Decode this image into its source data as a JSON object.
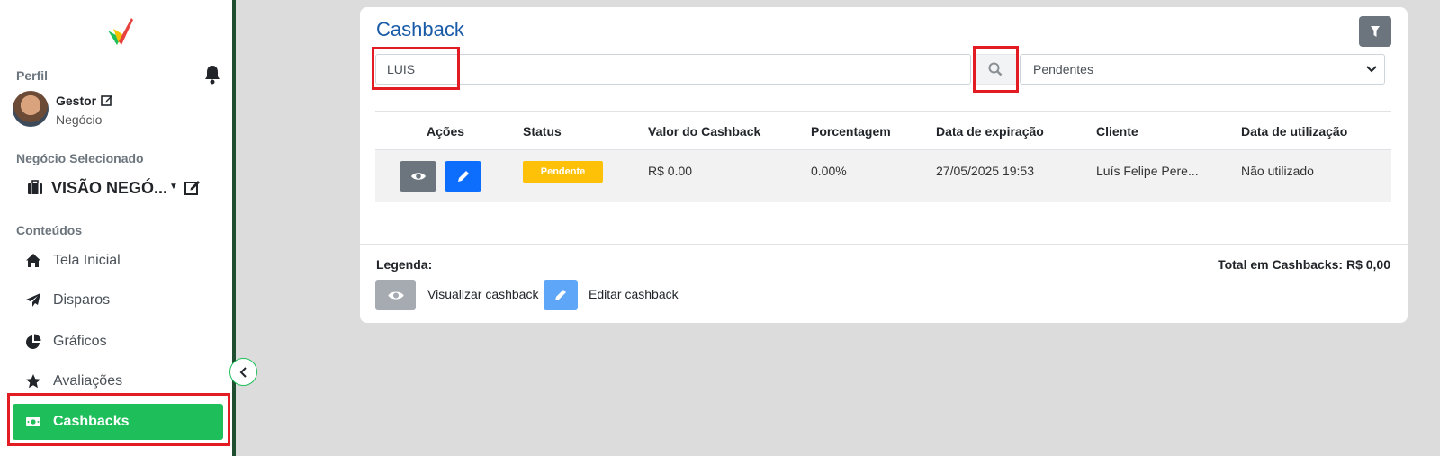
{
  "sidebar": {
    "profile_label": "Perfil",
    "user": {
      "name": "Gestor",
      "role": "Negócio"
    },
    "business_label": "Negócio Selecionado",
    "business_name": "VISÃO NEGÓ...",
    "business_caret": "▼",
    "contents_label": "Conteúdos",
    "items": [
      {
        "label": "Tela Inicial",
        "icon": "home-icon"
      },
      {
        "label": "Disparos",
        "icon": "paper-plane-icon"
      },
      {
        "label": "Gráficos",
        "icon": "pie-chart-icon"
      },
      {
        "label": "Avaliações",
        "icon": "star-icon"
      },
      {
        "label": "Cashbacks",
        "icon": "money-icon",
        "active": true
      }
    ]
  },
  "main": {
    "title": "Cashback",
    "search_value": "LUIS",
    "status_filter": "Pendentes",
    "table": {
      "headers": [
        "Ações",
        "Status",
        "Valor do Cashback",
        "Porcentagem",
        "Data de expiração",
        "Cliente",
        "Data de utilização"
      ],
      "rows": [
        {
          "status": "Pendente",
          "valor": "R$ 0.00",
          "porcentagem": "0.00%",
          "expiracao": "27/05/2025 19:53",
          "cliente": "Luís Felipe Pere...",
          "utilizacao": "Não utilizado"
        }
      ]
    },
    "legend": {
      "title": "Legenda:",
      "view_label": "Visualizar cashback",
      "edit_label": "Editar cashback"
    },
    "total": "Total em Cashbacks: R$ 0,00"
  },
  "colors": {
    "accent_green": "#1ebf5a",
    "title_blue": "#1a5ba8",
    "badge_yellow": "#ffc107",
    "edit_blue": "#0d6efd",
    "view_gray": "#6c757d",
    "highlight_red": "#e31b23"
  }
}
